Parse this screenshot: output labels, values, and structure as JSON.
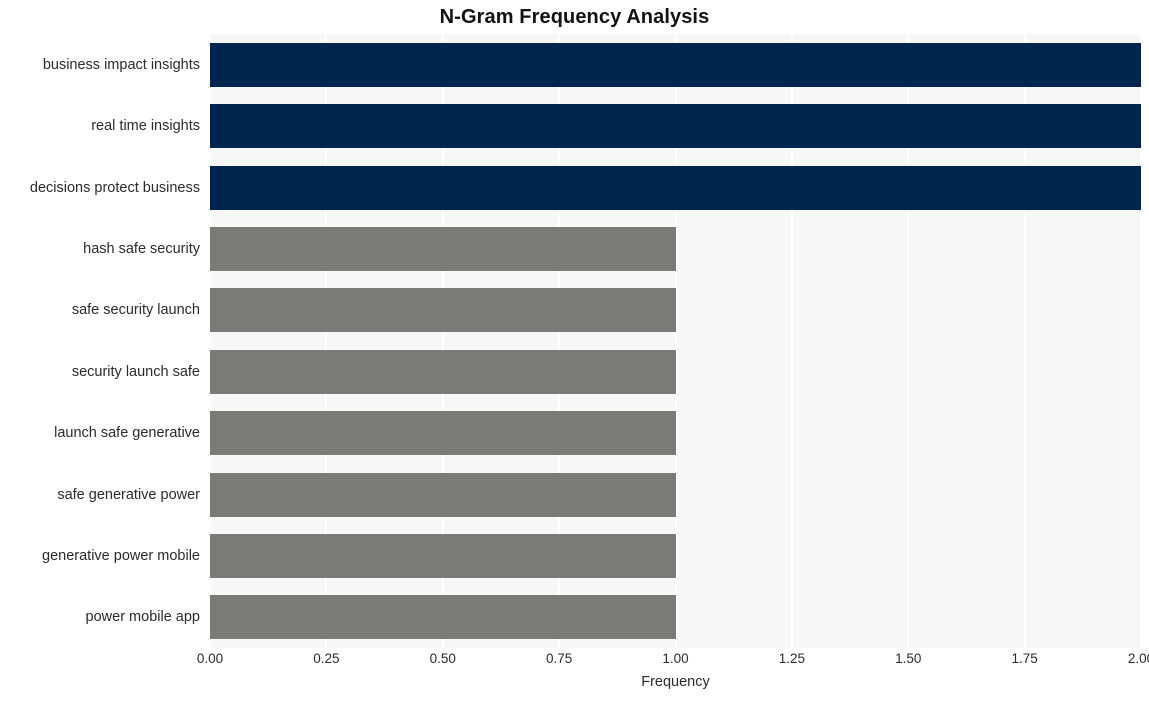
{
  "chart_data": {
    "type": "bar",
    "orientation": "horizontal",
    "title": "N-Gram Frequency Analysis",
    "xlabel": "Frequency",
    "ylabel": "",
    "categories": [
      "business impact insights",
      "real time insights",
      "decisions protect business",
      "hash safe security",
      "safe security launch",
      "security launch safe",
      "launch safe generative",
      "safe generative power",
      "generative power mobile",
      "power mobile app"
    ],
    "values": [
      2,
      2,
      2,
      1,
      1,
      1,
      1,
      1,
      1,
      1
    ],
    "bar_colors": [
      "#00264f",
      "#00264f",
      "#00264f",
      "#7a7a78",
      "#7a7a78",
      "#7a7a78",
      "#7a7a78",
      "#7a7a78",
      "#7a7a78",
      "#7a7a78"
    ],
    "xlim": [
      0,
      2
    ],
    "xticks": [
      0,
      0.25,
      0.5,
      0.75,
      1,
      1.25,
      1.5,
      1.75,
      2
    ],
    "xtick_labels": [
      "0.00",
      "0.25",
      "0.50",
      "0.75",
      "1.00",
      "1.25",
      "1.50",
      "1.75",
      "2.00"
    ],
    "grid": true,
    "grid_axis": "x",
    "grid_color": "#ffffff",
    "legend": null,
    "plot_background": "#f7f7f7",
    "figure_background": "#ffffff",
    "colors": {
      "highlight": "#00264f",
      "standard": "#7a7a78",
      "text": "#2b2b2b",
      "title": "#121212"
    }
  }
}
